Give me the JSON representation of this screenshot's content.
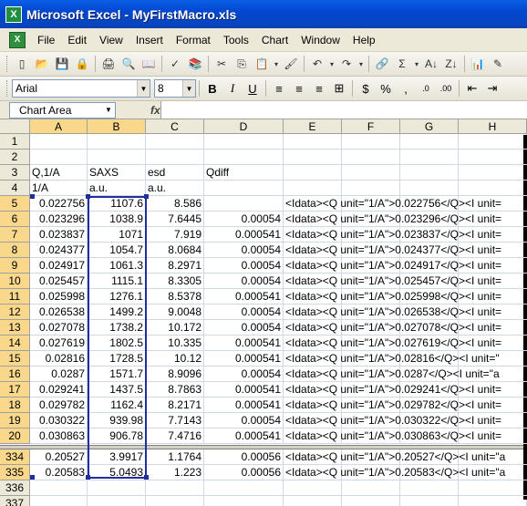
{
  "window": {
    "title": "Microsoft Excel - MyFirstMacro.xls"
  },
  "menu": [
    "File",
    "Edit",
    "View",
    "Insert",
    "Format",
    "Tools",
    "Chart",
    "Window",
    "Help"
  ],
  "font": {
    "name": "Arial",
    "size": "8"
  },
  "namebox": "Chart Area",
  "fx_label": "fx",
  "columns": [
    "A",
    "B",
    "C",
    "D",
    "E",
    "F",
    "G",
    "H"
  ],
  "rows_top": [
    {
      "n": "1",
      "a": "",
      "b": "",
      "c": "",
      "d": "",
      "e": ""
    },
    {
      "n": "2",
      "a": "",
      "b": "",
      "c": "",
      "d": "",
      "e": ""
    },
    {
      "n": "3",
      "a": "Q,1/A",
      "b": "SAXS",
      "c": "esd",
      "d": "Qdiff",
      "e": ""
    },
    {
      "n": "4",
      "a": "1/A",
      "b": "a.u.",
      "c": "a.u.",
      "d": "",
      "e": ""
    },
    {
      "n": "5",
      "a": "0.022756",
      "b": "1107.6",
      "c": "8.586",
      "d": "",
      "e": "<Idata><Q unit=\"1/A\">0.022756</Q><I unit="
    },
    {
      "n": "6",
      "a": "0.023296",
      "b": "1038.9",
      "c": "7.6445",
      "d": "0.00054",
      "e": "<Idata><Q unit=\"1/A\">0.023296</Q><I unit="
    },
    {
      "n": "7",
      "a": "0.023837",
      "b": "1071",
      "c": "7.919",
      "d": "0.000541",
      "e": "<Idata><Q unit=\"1/A\">0.023837</Q><I unit="
    },
    {
      "n": "8",
      "a": "0.024377",
      "b": "1054.7",
      "c": "8.0684",
      "d": "0.00054",
      "e": "<Idata><Q unit=\"1/A\">0.024377</Q><I unit="
    },
    {
      "n": "9",
      "a": "0.024917",
      "b": "1061.3",
      "c": "8.2971",
      "d": "0.00054",
      "e": "<Idata><Q unit=\"1/A\">0.024917</Q><I unit="
    },
    {
      "n": "10",
      "a": "0.025457",
      "b": "1115.1",
      "c": "8.3305",
      "d": "0.00054",
      "e": "<Idata><Q unit=\"1/A\">0.025457</Q><I unit="
    },
    {
      "n": "11",
      "a": "0.025998",
      "b": "1276.1",
      "c": "8.5378",
      "d": "0.000541",
      "e": "<Idata><Q unit=\"1/A\">0.025998</Q><I unit="
    },
    {
      "n": "12",
      "a": "0.026538",
      "b": "1499.2",
      "c": "9.0048",
      "d": "0.00054",
      "e": "<Idata><Q unit=\"1/A\">0.026538</Q><I unit="
    },
    {
      "n": "13",
      "a": "0.027078",
      "b": "1738.2",
      "c": "10.172",
      "d": "0.00054",
      "e": "<Idata><Q unit=\"1/A\">0.027078</Q><I unit="
    },
    {
      "n": "14",
      "a": "0.027619",
      "b": "1802.5",
      "c": "10.335",
      "d": "0.000541",
      "e": "<Idata><Q unit=\"1/A\">0.027619</Q><I unit="
    },
    {
      "n": "15",
      "a": "0.02816",
      "b": "1728.5",
      "c": "10.12",
      "d": "0.000541",
      "e": "<Idata><Q unit=\"1/A\">0.02816</Q><I unit=\""
    },
    {
      "n": "16",
      "a": "0.0287",
      "b": "1571.7",
      "c": "8.9096",
      "d": "0.00054",
      "e": "<Idata><Q unit=\"1/A\">0.0287</Q><I unit=\"a"
    },
    {
      "n": "17",
      "a": "0.029241",
      "b": "1437.5",
      "c": "8.7863",
      "d": "0.000541",
      "e": "<Idata><Q unit=\"1/A\">0.029241</Q><I unit="
    },
    {
      "n": "18",
      "a": "0.029782",
      "b": "1162.4",
      "c": "8.2171",
      "d": "0.000541",
      "e": "<Idata><Q unit=\"1/A\">0.029782</Q><I unit="
    },
    {
      "n": "19",
      "a": "0.030322",
      "b": "939.98",
      "c": "7.7143",
      "d": "0.00054",
      "e": "<Idata><Q unit=\"1/A\">0.030322</Q><I unit="
    },
    {
      "n": "20",
      "a": "0.030863",
      "b": "906.78",
      "c": "7.4716",
      "d": "0.000541",
      "e": "<Idata><Q unit=\"1/A\">0.030863</Q><I unit="
    }
  ],
  "rows_bottom": [
    {
      "n": "334",
      "a": "0.20527",
      "b": "3.9917",
      "c": "1.1764",
      "d": "0.00056",
      "e": "<Idata><Q unit=\"1/A\">0.20527</Q><I unit=\"a"
    },
    {
      "n": "335",
      "a": "0.20583",
      "b": "5.0493",
      "c": "1.223",
      "d": "0.00056",
      "e": "<Idata><Q unit=\"1/A\">0.20583</Q><I unit=\"a"
    },
    {
      "n": "336",
      "a": "",
      "b": "",
      "c": "",
      "d": "",
      "e": ""
    },
    {
      "n": "337",
      "a": "",
      "b": "",
      "c": "",
      "d": "",
      "e": ""
    }
  ]
}
